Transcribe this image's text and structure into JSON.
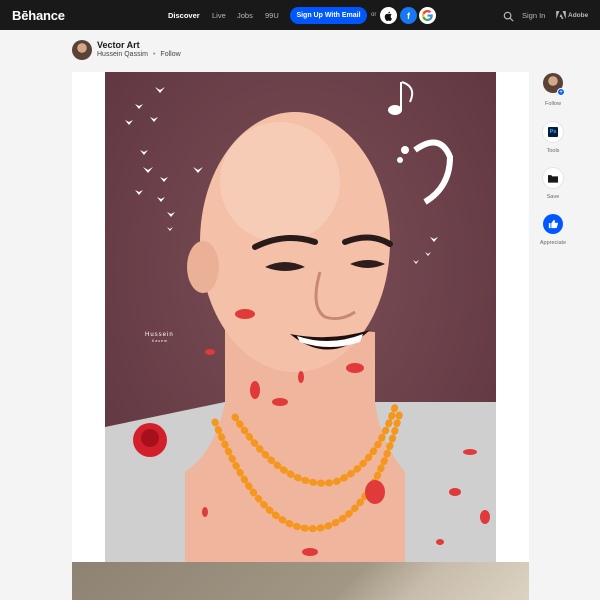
{
  "topbar": {
    "brand": "Bēhance",
    "nav": [
      "Discover",
      "Live",
      "Jobs",
      "99U"
    ],
    "signup_label": "Sign Up With Email",
    "or_label": "or",
    "social": [
      "apple-icon",
      "facebook-icon",
      "google-icon"
    ],
    "signin_label": "Sign In",
    "adobe_label": "Adobe"
  },
  "project": {
    "title": "Vector Art",
    "owner": "Hussein Qassim",
    "follow_label": "Follow"
  },
  "artwork": {
    "signature_top": "Hussein",
    "signature_bottom": "Kasem"
  },
  "rail": {
    "follow_label": "Follow",
    "tools_label": "Tools",
    "save_label": "Save",
    "appreciate_label": "Appreciate",
    "tools_icon_text": "Ps"
  },
  "colors": {
    "topbar_bg": "#191919",
    "accent": "#0057ff",
    "art_bg": "#6b3f47"
  }
}
